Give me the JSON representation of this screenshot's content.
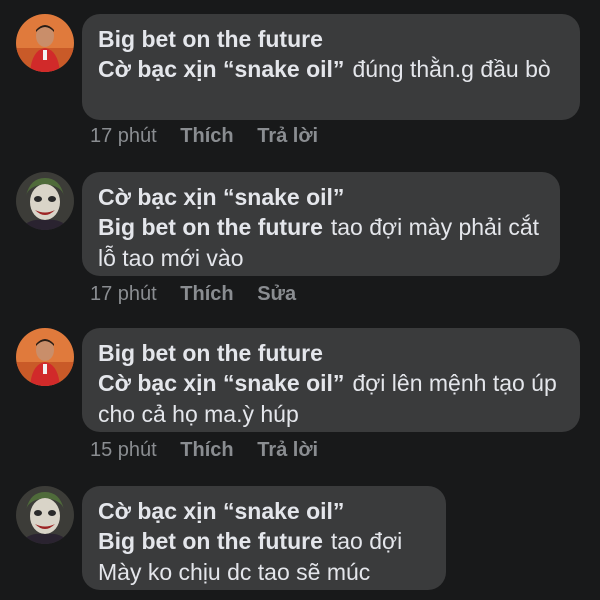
{
  "comments": [
    {
      "author": "Big bet on the future",
      "mention": "Cờ bạc xịn “snake oil”",
      "text": "đúng thằn.g đầu bò",
      "time": "17 phút",
      "like_label": "Thích",
      "action_label": "Trả lời",
      "avatar_icon": "tennis-player-avatar"
    },
    {
      "author": "Cờ bạc xịn “snake oil”",
      "mention": "Big bet on the future",
      "text": "tao đợi mày phải cắt lỗ tao mới vào",
      "time": "17 phút",
      "like_label": "Thích",
      "action_label": "Sửa",
      "avatar_icon": "joker-avatar"
    },
    {
      "author": "Big bet on the future",
      "mention": "Cờ bạc xịn “snake oil”",
      "text": "đợi lên mệnh tạo úp cho cả họ ma.ỳ húp",
      "time": "15 phút",
      "like_label": "Thích",
      "action_label": "Trả lời",
      "avatar_icon": "tennis-player-avatar"
    },
    {
      "author": "Cờ bạc xịn “snake oil”",
      "mention": "Big bet on the future",
      "text": "tao đợi Mày ko chịu dc tao sẽ múc",
      "time": "",
      "like_label": "",
      "action_label": "",
      "avatar_icon": "joker-avatar"
    }
  ],
  "colors": {
    "background": "#18191a",
    "bubble": "#3a3b3c",
    "text": "#e4e6eb",
    "meta": "#8a8d91"
  }
}
